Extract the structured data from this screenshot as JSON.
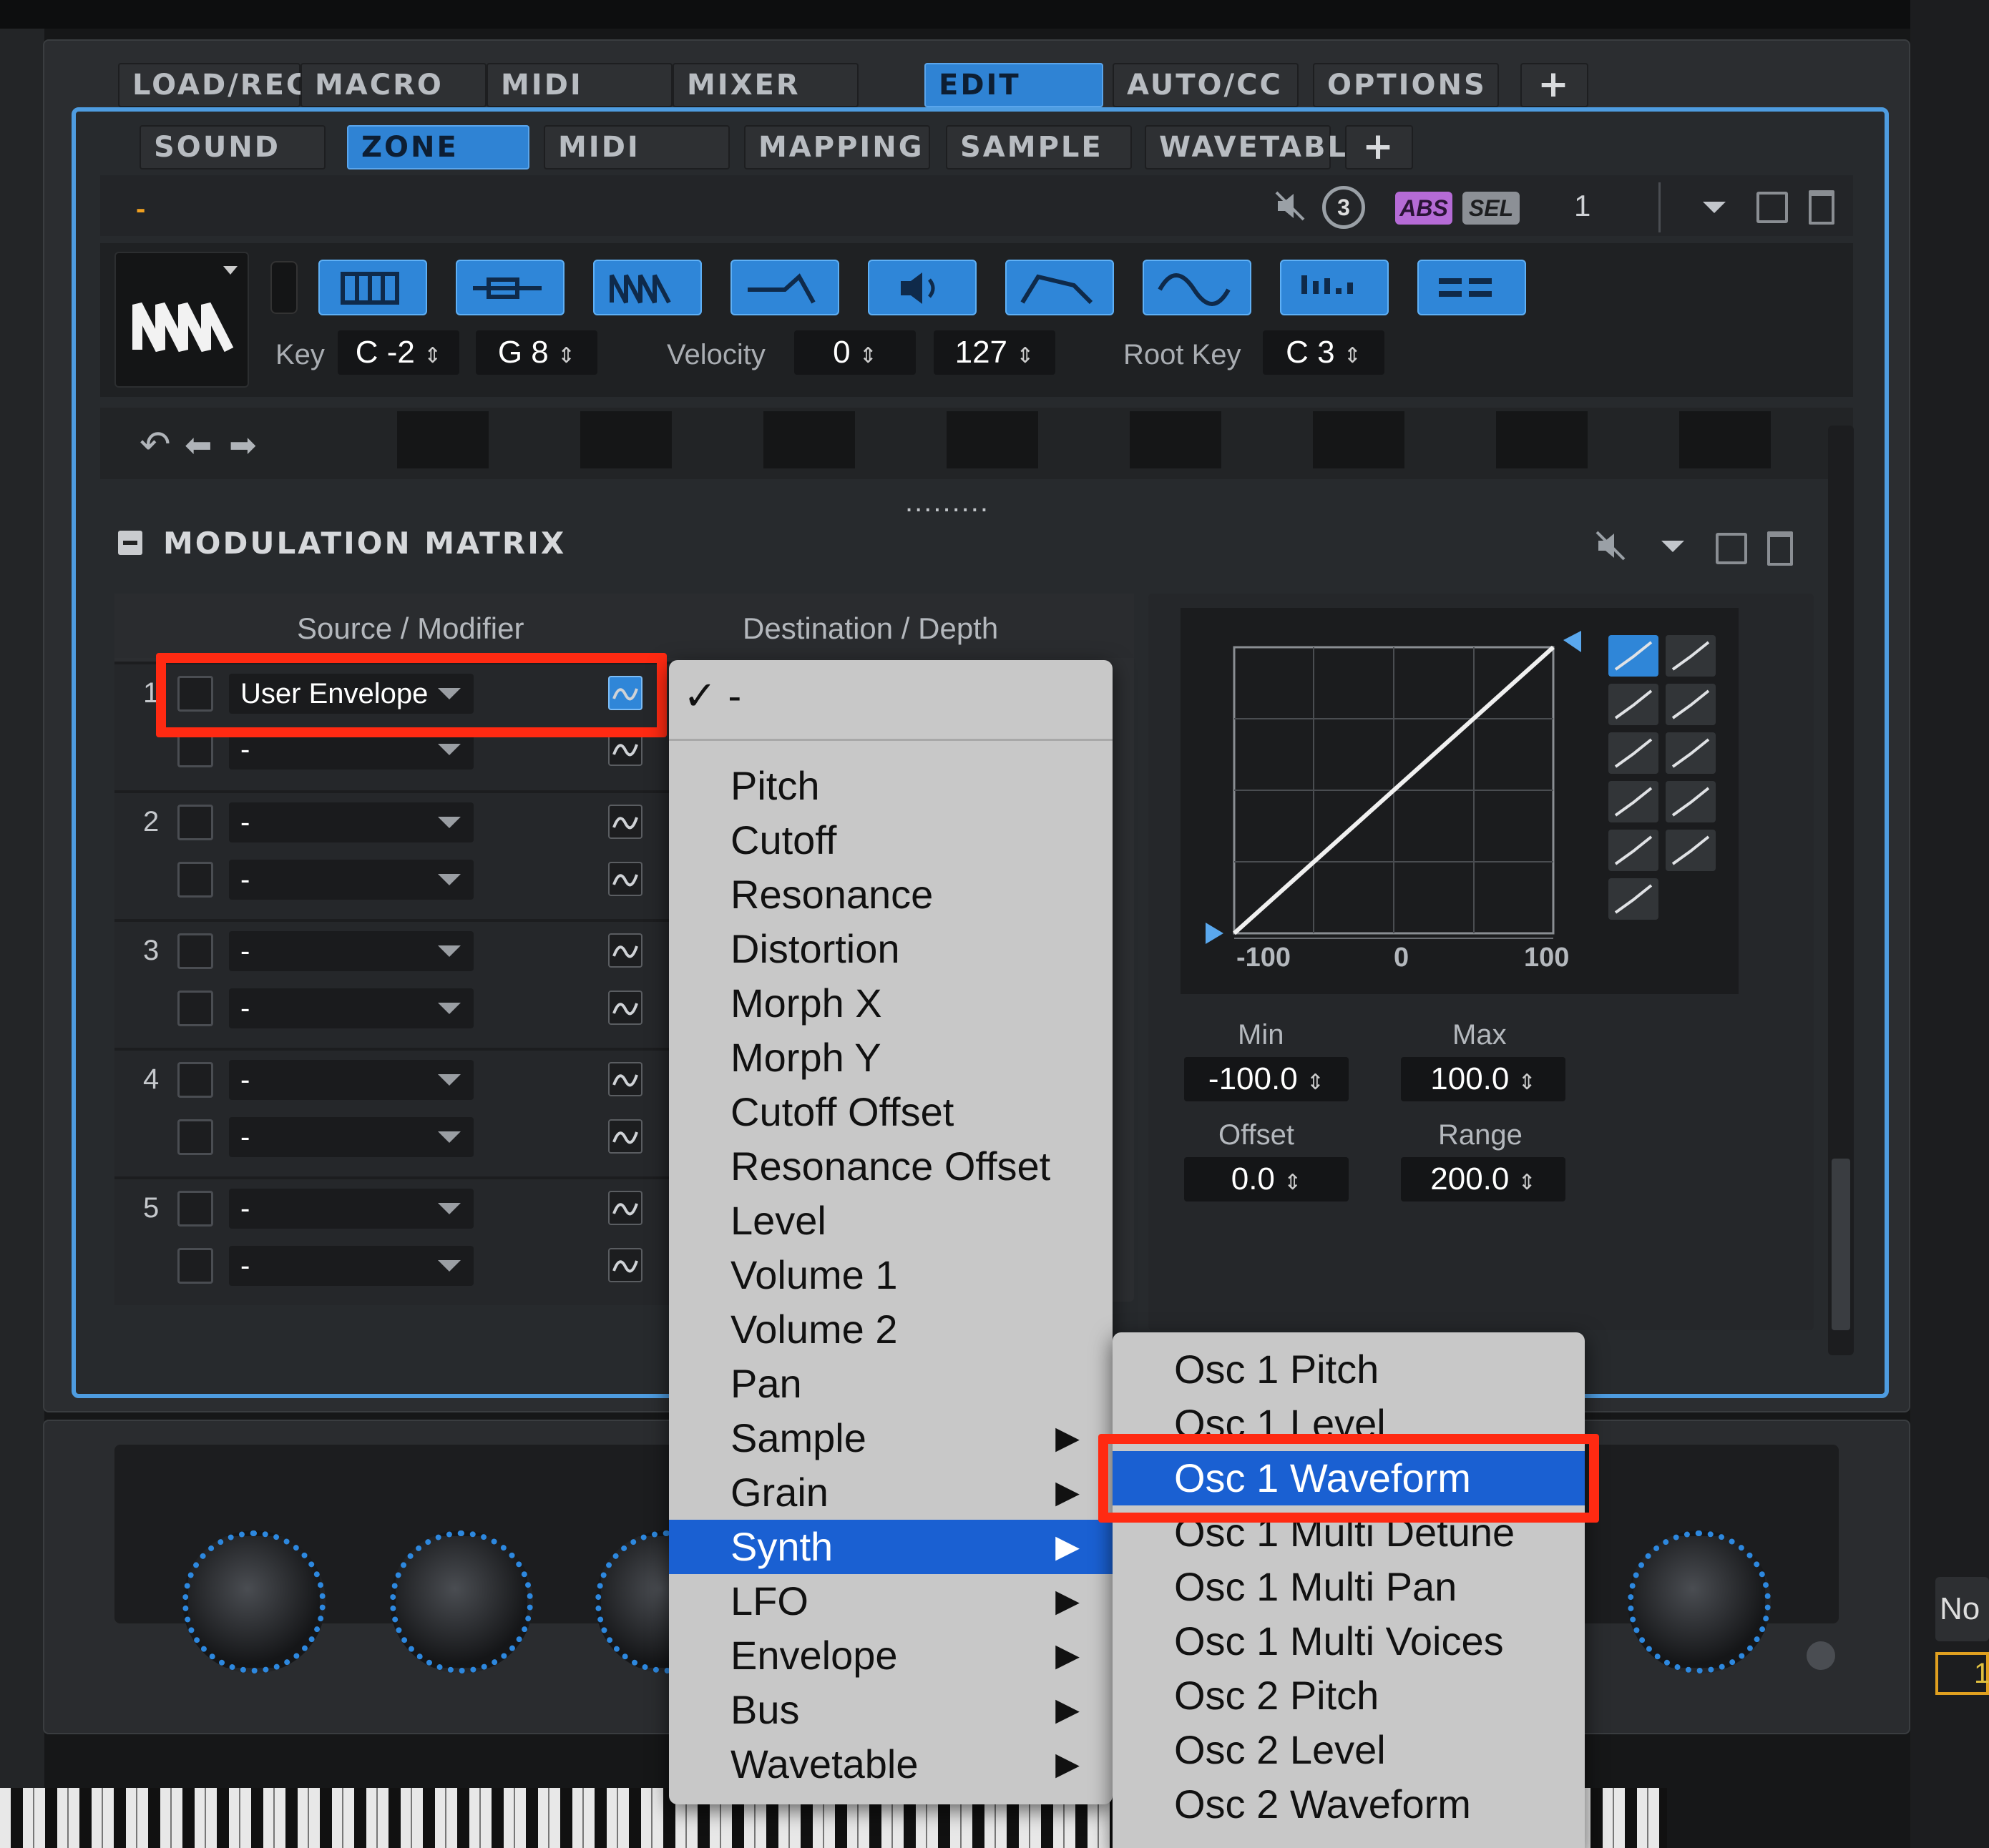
{
  "main_tabs": [
    {
      "label": "LOAD/REC",
      "active": false
    },
    {
      "label": "MACRO",
      "active": false
    },
    {
      "label": "MIDI",
      "active": false
    },
    {
      "label": "MIXER",
      "active": false
    },
    {
      "label": "EDIT",
      "active": true
    },
    {
      "label": "AUTO/CC",
      "active": false
    },
    {
      "label": "OPTIONS",
      "active": false
    },
    {
      "label": "+",
      "active": false
    }
  ],
  "sub_tabs": [
    {
      "label": "SOUND",
      "active": false
    },
    {
      "label": "ZONE",
      "active": true
    },
    {
      "label": "MIDI MOD",
      "active": false
    },
    {
      "label": "MAPPING",
      "active": false
    },
    {
      "label": "SAMPLE",
      "active": false
    },
    {
      "label": "WAVETABLE",
      "active": false
    },
    {
      "label": "+",
      "active": false
    }
  ],
  "toolbar": {
    "indicator": "-",
    "abs_label": "ABS",
    "sel_label": "SEL",
    "layer_number": "1",
    "badge_number": "3"
  },
  "zone_params": {
    "key_label": "Key",
    "key_low": "C -2",
    "key_high": "G 8",
    "velocity_label": "Velocity",
    "vel_low": "0",
    "vel_high": "127",
    "root_key_label": "Root Key",
    "root_key": "C 3"
  },
  "mod_matrix": {
    "title": "MODULATION MATRIX",
    "col_source": "Source / Modifier",
    "col_destination": "Destination / Depth",
    "rows": [
      {
        "number": "1",
        "source": "User Envelope",
        "modifier": "-"
      },
      {
        "number": "2",
        "source": "-",
        "modifier": "-"
      },
      {
        "number": "3",
        "source": "-",
        "modifier": "-"
      },
      {
        "number": "4",
        "source": "-",
        "modifier": "-"
      },
      {
        "number": "5",
        "source": "-",
        "modifier": "-"
      }
    ]
  },
  "curve": {
    "axis_ticks": [
      "-100",
      "0",
      "100"
    ],
    "min_label": "Min",
    "min_value": "-100.0",
    "max_label": "Max",
    "max_value": "100.0",
    "offset_label": "Offset",
    "offset_value": "0.0",
    "range_label": "Range",
    "range_value": "200.0"
  },
  "destination_menu": {
    "checked_item": "-",
    "items": [
      {
        "label": "Pitch",
        "submenu": false,
        "selected": false
      },
      {
        "label": "Cutoff",
        "submenu": false,
        "selected": false
      },
      {
        "label": "Resonance",
        "submenu": false,
        "selected": false
      },
      {
        "label": "Distortion",
        "submenu": false,
        "selected": false
      },
      {
        "label": "Morph X",
        "submenu": false,
        "selected": false
      },
      {
        "label": "Morph Y",
        "submenu": false,
        "selected": false
      },
      {
        "label": "Cutoff Offset",
        "submenu": false,
        "selected": false
      },
      {
        "label": "Resonance Offset",
        "submenu": false,
        "selected": false
      },
      {
        "label": "Level",
        "submenu": false,
        "selected": false
      },
      {
        "label": "Volume 1",
        "submenu": false,
        "selected": false
      },
      {
        "label": "Volume 2",
        "submenu": false,
        "selected": false
      },
      {
        "label": "Pan",
        "submenu": false,
        "selected": false
      },
      {
        "label": "Sample",
        "submenu": true,
        "selected": false
      },
      {
        "label": "Grain",
        "submenu": true,
        "selected": false
      },
      {
        "label": "Synth",
        "submenu": true,
        "selected": true
      },
      {
        "label": "LFO",
        "submenu": true,
        "selected": false
      },
      {
        "label": "Envelope",
        "submenu": true,
        "selected": false
      },
      {
        "label": "Bus",
        "submenu": true,
        "selected": false
      },
      {
        "label": "Wavetable",
        "submenu": true,
        "selected": false
      }
    ]
  },
  "synth_submenu": {
    "items": [
      {
        "label": "Osc 1 Pitch",
        "selected": false
      },
      {
        "label": "Osc 1 Level",
        "selected": false
      },
      {
        "label": "Osc 1 Waveform",
        "selected": true
      },
      {
        "label": "Osc 1 Multi Detune",
        "selected": false
      },
      {
        "label": "Osc 1 Multi Pan",
        "selected": false
      },
      {
        "label": "Osc 1 Multi Voices",
        "selected": false
      },
      {
        "label": "Osc 2 Pitch",
        "selected": false
      },
      {
        "label": "Osc 2 Level",
        "selected": false
      },
      {
        "label": "Osc 2 Waveform",
        "selected": false
      }
    ]
  },
  "right_panel": {
    "no_label": "No",
    "row_number": "1"
  },
  "colors": {
    "accent": "#2f86d8",
    "highlight": "#1a60d2",
    "annotation": "#ff2a12",
    "panel_border": "#4e9ce0"
  }
}
